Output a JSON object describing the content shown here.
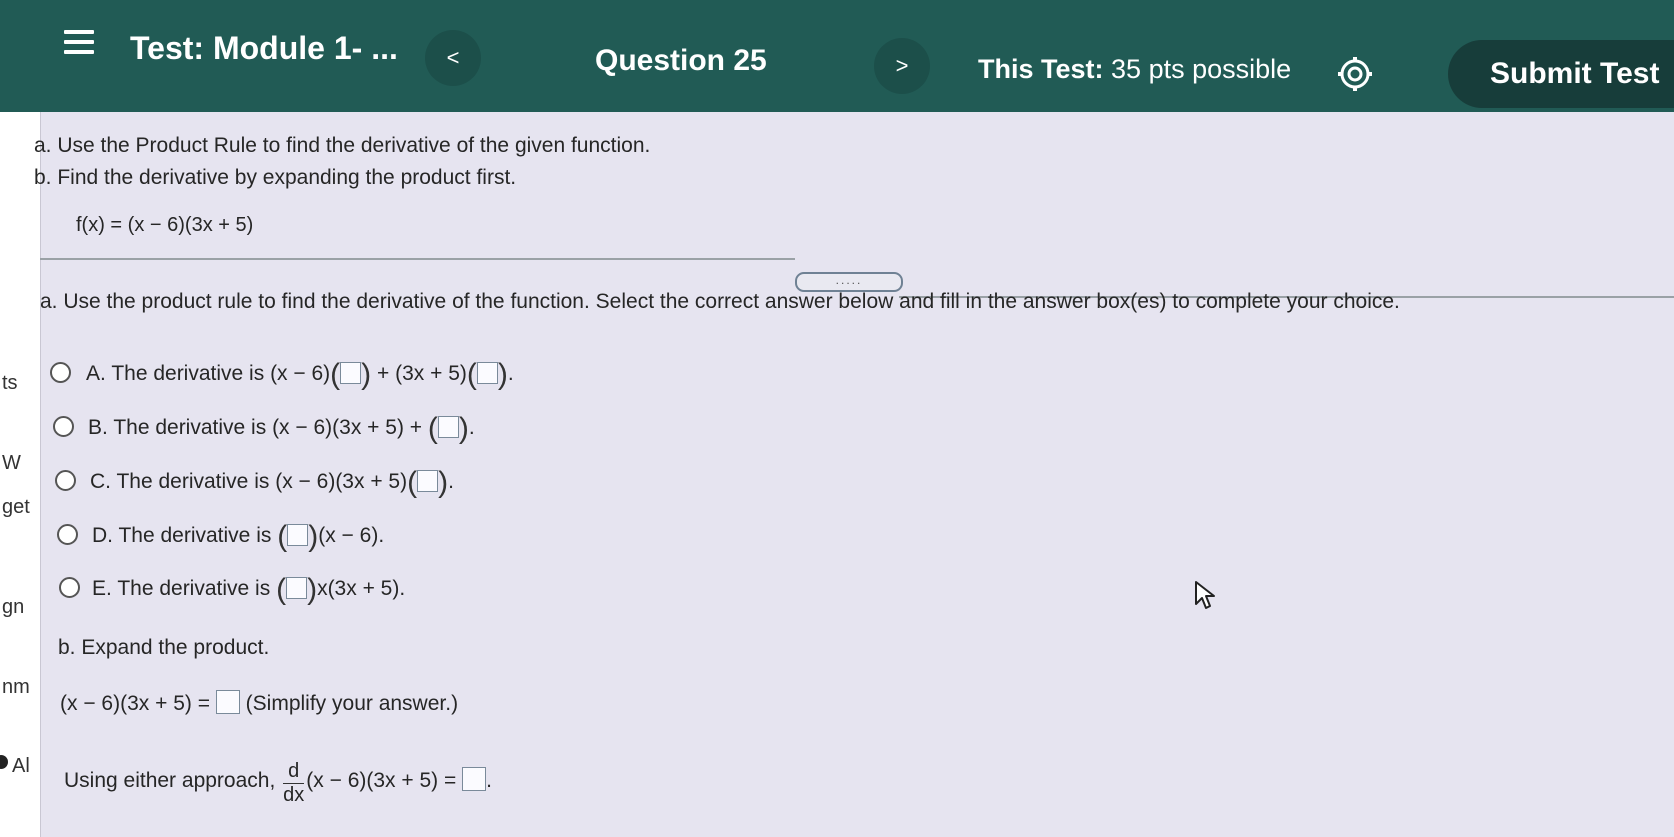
{
  "header": {
    "test_title": "Test: Module 1- ...",
    "prev": "<",
    "question": "Question 25",
    "next": ">",
    "points_prefix": "This Test:",
    "points": "35 pts possible",
    "submit": "Submit Test"
  },
  "left_strip": [
    "ts",
    "W",
    "get",
    "gn",
    "nm",
    "Al"
  ],
  "problem": {
    "part_a": "a. Use the Product Rule to find the derivative of the given function.",
    "part_b": "b. Find the derivative by expanding the product first.",
    "function": "f(x) = (x − 6)(3x + 5)"
  },
  "handle": ".....",
  "question_a": "a. Use the product rule to find the derivative of the function. Select the correct answer below and fill in the answer box(es) to complete your choice.",
  "options": {
    "A": {
      "letter": "A.",
      "text": "The derivative is",
      "pre": "(x − 6)",
      "mid": " + (3x + 5)",
      "post": "."
    },
    "B": {
      "letter": "B.",
      "text": "The derivative is",
      "pre": "(x − 6)(3x + 5) + ",
      "post": "."
    },
    "C": {
      "letter": "C.",
      "text": "The derivative is",
      "pre": "(x − 6)(3x + 5)",
      "post": "."
    },
    "D": {
      "letter": "D.",
      "text": "The derivative is",
      "post": "(x − 6)."
    },
    "E": {
      "letter": "E.",
      "text": "The derivative is",
      "post": "x(3x + 5)."
    }
  },
  "question_b": "b. Expand the product.",
  "expand": {
    "lhs": "(x − 6)(3x + 5) =",
    "hint": "(Simplify your answer.)"
  },
  "final": {
    "prefix": "Using either approach,",
    "num": "d",
    "den": "dx",
    "expr": "(x − 6)(3x + 5) =",
    "post": "."
  },
  "colors": {
    "header": "#215b55",
    "submit": "#173d3a",
    "background": "#e6e4f0"
  }
}
